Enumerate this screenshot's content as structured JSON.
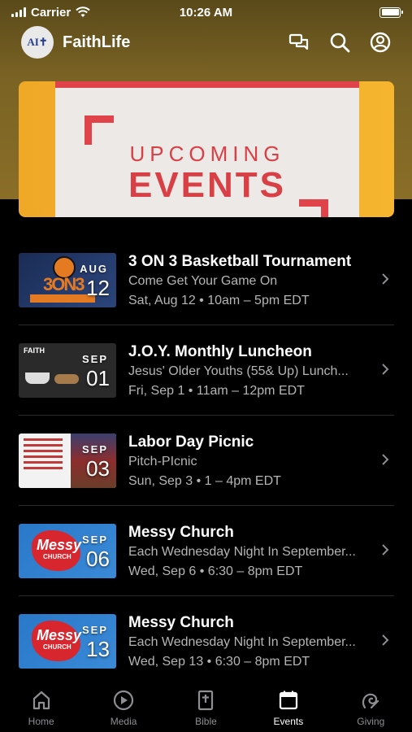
{
  "status": {
    "carrier": "Carrier",
    "time": "10:26 AM"
  },
  "app": {
    "title": "FaithLife",
    "logo_text": "AI✝"
  },
  "banner": {
    "line1": "UPCOMING",
    "line2": "EVENTS"
  },
  "events": [
    {
      "title": "3 ON 3 Basketball Tournament",
      "subtitle": "Come Get Your Game On",
      "time": "Sat, Aug 12 • 10am – 5pm EDT",
      "month": "AUG",
      "day": "12"
    },
    {
      "title": "J.O.Y. Monthly Luncheon",
      "subtitle": "Jesus' Older Youths (55& Up) Lunch...",
      "time": "Fri, Sep 1 • 11am – 12pm EDT",
      "month": "SEP",
      "day": "01"
    },
    {
      "title": "Labor Day Picnic",
      "subtitle": "Pitch-PIcnic",
      "time": "Sun, Sep 3 • 1 – 4pm EDT",
      "month": "SEP",
      "day": "03"
    },
    {
      "title": "Messy Church",
      "subtitle": "Each Wednesday Night In September...",
      "time": "Wed, Sep 6 • 6:30 – 8pm EDT",
      "month": "SEP",
      "day": "06"
    },
    {
      "title": "Messy Church",
      "subtitle": "Each Wednesday Night In September...",
      "time": "Wed, Sep 13 • 6:30 – 8pm EDT",
      "month": "SEP",
      "day": "13"
    }
  ],
  "thumb_text": {
    "faith": "FAITH",
    "messy": "Messy",
    "messy_church": "CHURCH",
    "basket": "3ON3"
  },
  "tabs": [
    {
      "label": "Home",
      "icon": "home-icon"
    },
    {
      "label": "Media",
      "icon": "play-icon"
    },
    {
      "label": "Bible",
      "icon": "bible-icon"
    },
    {
      "label": "Events",
      "icon": "calendar-icon",
      "active": true
    },
    {
      "label": "Giving",
      "icon": "giving-icon"
    }
  ],
  "colors": {
    "accent": "#e0434a",
    "banner_gold": "#f5b52e",
    "header_gold": "#8a6e28"
  }
}
